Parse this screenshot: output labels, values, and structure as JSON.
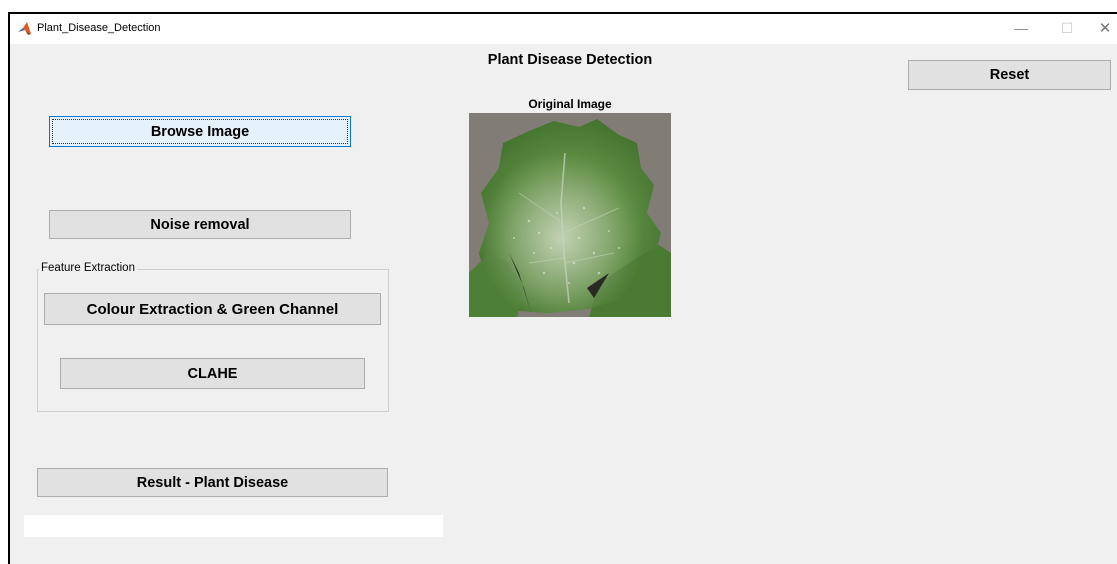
{
  "window": {
    "title": "Plant_Disease_Detection",
    "controls": {
      "minimize": "—",
      "maximize": "☐",
      "close": "✕"
    }
  },
  "main_title": "Plant Disease Detection",
  "buttons": {
    "browse": "Browse Image",
    "noise": "Noise removal",
    "colour": "Colour Extraction & Green Channel",
    "clahe": "CLAHE",
    "result": "Result - Plant Disease",
    "reset": "Reset"
  },
  "feature_panel": {
    "title": "Feature Extraction"
  },
  "image_panel": {
    "title": "Original Image"
  },
  "result_field": {
    "value": ""
  },
  "icons": {
    "app": "matlab-icon",
    "minimize": "minimize-icon",
    "maximize": "maximize-icon",
    "close": "close-icon"
  },
  "colors": {
    "background": "#f0f0f0",
    "button": "#e1e1e1",
    "button_focus": "#e5f1fb",
    "focus_border": "#0078d7",
    "leaf_green": "#4f8a3a"
  }
}
